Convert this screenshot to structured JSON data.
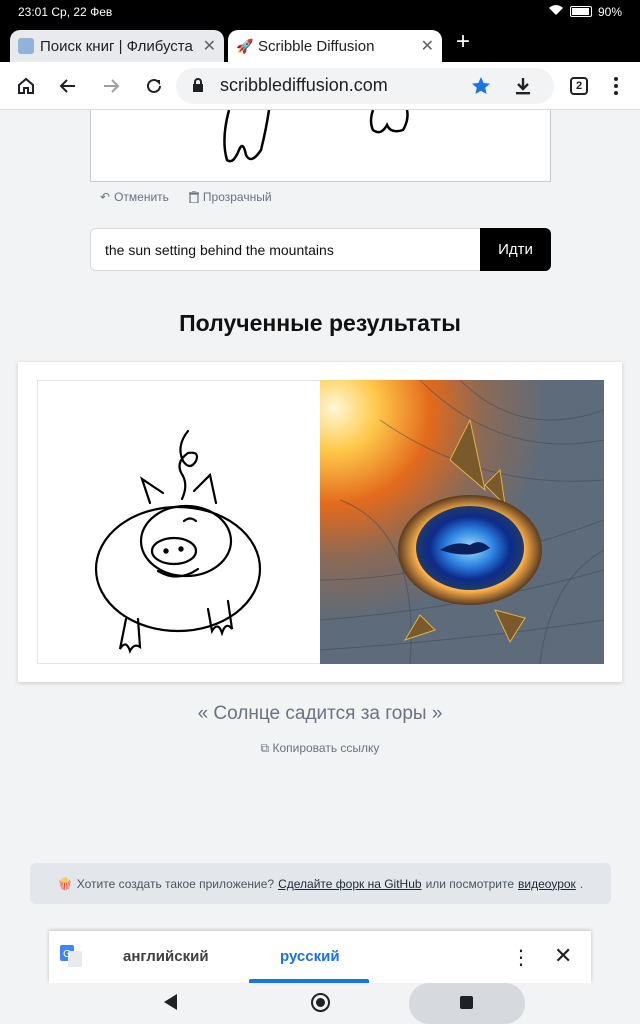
{
  "status_bar": {
    "time": "23:01",
    "date": "Ср, 22 Фев",
    "battery": "90%"
  },
  "tabs": [
    {
      "title": "Поиск книг | Флибуста",
      "active": false
    },
    {
      "title": "Scribble Diffusion",
      "active": true
    }
  ],
  "toolbar": {
    "url": "scribblediffusion.com",
    "tab_count": "2"
  },
  "canvas_tools": {
    "undo": "Отменить",
    "clear": "Прозрачный"
  },
  "prompt": {
    "value": "the sun setting behind the mountains",
    "button": "Идти"
  },
  "results": {
    "title": "Полученные результаты",
    "caption": "« Солнце садится за горы »",
    "copy_link": "Копировать ссылку"
  },
  "banner": {
    "text_before": "Хотите создать такое приложение?",
    "link_github": "Сделайте форк на GitHub",
    "text_middle": "или посмотрите",
    "link_video": "видеоурок",
    "text_end": "."
  },
  "translate_bar": {
    "source_lang": "английский",
    "target_lang": "русский"
  },
  "colors": {
    "accent": "#1a73e8",
    "button_bg": "#000000",
    "page_bg": "#f1f3f5"
  }
}
